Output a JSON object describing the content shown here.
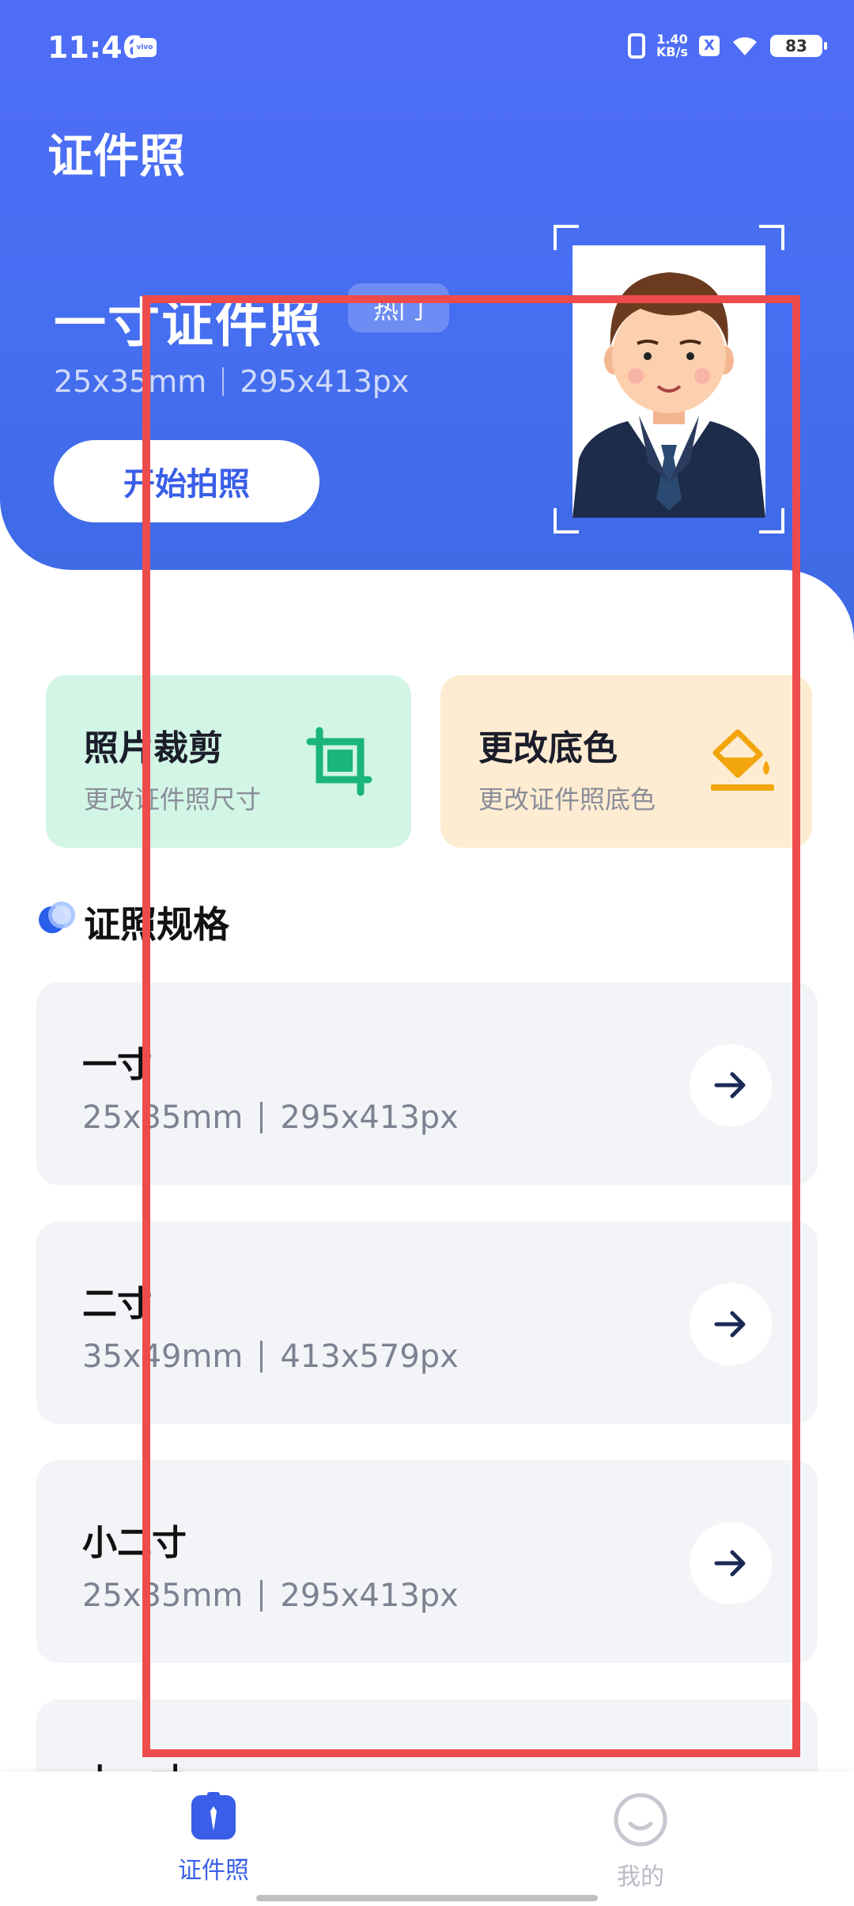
{
  "status_bar": {
    "time": "11:46",
    "vivo": "vivo",
    "net_speed_value": "1.40",
    "net_speed_unit": "KB/s",
    "x_icon": "X",
    "battery": "83"
  },
  "header": {
    "title": "证件照"
  },
  "hero": {
    "title": "一寸证件照",
    "badge": "热门",
    "size_mm": "25x35mm",
    "size_px": "295x413px",
    "button": "开始拍照"
  },
  "features": [
    {
      "title": "照片裁剪",
      "subtitle": "更改证件照尺寸",
      "icon": "crop-icon"
    },
    {
      "title": "更改底色",
      "subtitle": "更改证件照底色",
      "icon": "paint-bucket-icon"
    }
  ],
  "section": {
    "title": "证照规格"
  },
  "specs": [
    {
      "name": "一寸",
      "mm": "25x35mm",
      "px": "295x413px"
    },
    {
      "name": "二寸",
      "mm": "35x49mm",
      "px": "413x579px"
    },
    {
      "name": "小二寸",
      "mm": "25x35mm",
      "px": "295x413px"
    },
    {
      "name": "小一寸"
    }
  ],
  "tabbar": {
    "items": [
      {
        "label": "证件照",
        "icon": "id-photo-icon",
        "active": true
      },
      {
        "label": "我的",
        "icon": "smile-face-icon",
        "active": false
      }
    ]
  },
  "colors": {
    "hero_blue": "#4f6df7",
    "accent_blue": "#3a5ee8",
    "crop_card": "#d2f5e6",
    "color_card": "#feecd2",
    "annotation_red": "#ee4c4c"
  }
}
